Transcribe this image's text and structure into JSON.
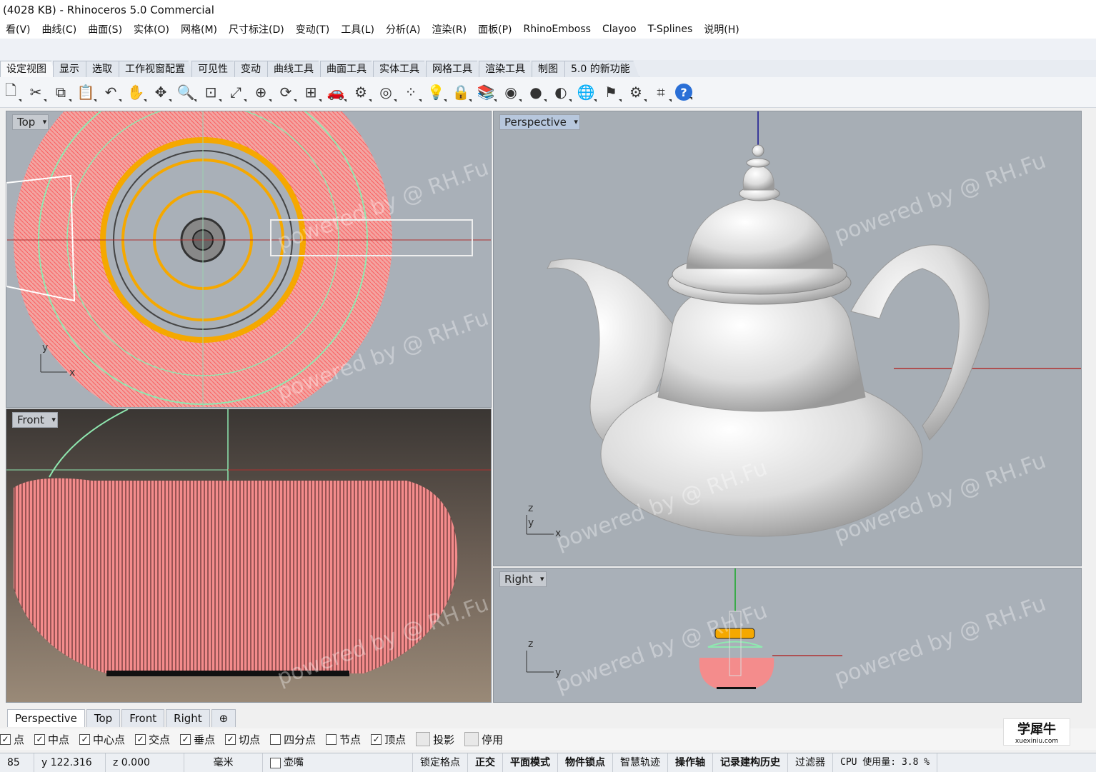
{
  "window": {
    "title": "(4028 KB) - Rhinoceros 5.0 Commercial"
  },
  "menu": [
    "看(V)",
    "曲线(C)",
    "曲面(S)",
    "实体(O)",
    "网格(M)",
    "尺寸标注(D)",
    "变动(T)",
    "工具(L)",
    "分析(A)",
    "渲染(R)",
    "面板(P)",
    "RhinoEmboss",
    "Clayoo",
    "T-Splines",
    "说明(H)"
  ],
  "tool_tabs": [
    "设定视图",
    "显示",
    "选取",
    "工作视窗配置",
    "可见性",
    "变动",
    "曲线工具",
    "曲面工具",
    "实体工具",
    "网格工具",
    "渲染工具",
    "制图",
    "5.0 的新功能"
  ],
  "toolbar_icons": [
    "new-icon",
    "cut-icon",
    "copy-icon",
    "paste-icon",
    "undo-icon",
    "pan-hand-icon",
    "move-icon",
    "zoom-icon",
    "zoom-window-icon",
    "zoom-extents-icon",
    "zoom-selected-icon",
    "rotate-view-icon",
    "four-view-icon",
    "car-icon",
    "properties-icon",
    "circle-snap-icon",
    "points-icon",
    "light-icon",
    "lock-icon",
    "layer-icon",
    "color-wheel-icon",
    "shade-sphere-icon",
    "render-sphere-icon",
    "globe-icon",
    "flag-icon",
    "settings-gear-icon",
    "grid-snap-icon",
    "help-icon"
  ],
  "viewports": {
    "top": {
      "label": "Top"
    },
    "front": {
      "label": "Front"
    },
    "perspective": {
      "label": "Perspective"
    },
    "right": {
      "label": "Right"
    }
  },
  "viewport_tabs": [
    "Perspective",
    "Top",
    "Front",
    "Right"
  ],
  "add_tab_symbol": "⊕",
  "osnap": [
    {
      "label": "点",
      "checked": true
    },
    {
      "label": "中点",
      "checked": true
    },
    {
      "label": "中心点",
      "checked": true
    },
    {
      "label": "交点",
      "checked": true
    },
    {
      "label": "垂点",
      "checked": true
    },
    {
      "label": "切点",
      "checked": true
    },
    {
      "label": "四分点",
      "checked": false
    },
    {
      "label": "节点",
      "checked": false
    },
    {
      "label": "顶点",
      "checked": true
    },
    {
      "label": "投影",
      "checked": false
    },
    {
      "label": "停用",
      "checked": false
    }
  ],
  "status": {
    "x": "85",
    "y": "y 122.316",
    "z": "z 0.000",
    "units": "毫米",
    "layer": "壶嘴",
    "grid_snap": "锁定格点",
    "ortho": "正交",
    "planar": "平面模式",
    "osnap": "物件锁点",
    "smarttrack": "智慧轨迹",
    "gumball": "操作轴",
    "history": "记录建构历史",
    "filter": "过滤器",
    "cpu": "CPU 使用量: 3.8 %"
  },
  "watermark": "powered by @ RH.Fu",
  "logo": {
    "name": "学犀牛",
    "url": "xuexiniu.com"
  },
  "colors": {
    "wire": "#ff6f6f",
    "select": "#f5a800",
    "viewport_bg": "#a9b0b8"
  }
}
